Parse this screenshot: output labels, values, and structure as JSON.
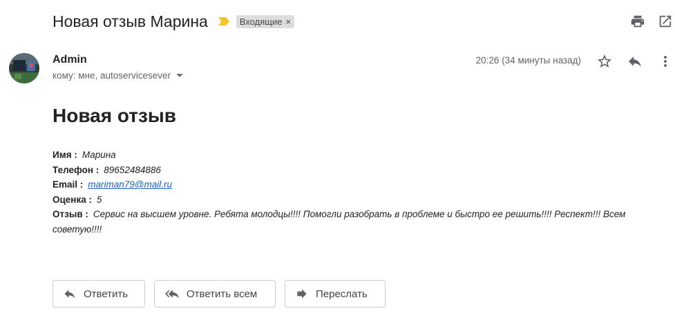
{
  "subject": {
    "title": "Новая отзыв Марина",
    "importance_icon": "importance-arrow",
    "label": "Входящие",
    "label_close": "×"
  },
  "toolbar": {
    "print_icon": "print-icon",
    "open_new_window_icon": "open-in-new-icon"
  },
  "message": {
    "sender_name": "Admin",
    "recipients": "кому: мне, autoservicesever",
    "timestamp": "20:26 (34 минуты назад)",
    "icons": [
      "star-icon",
      "reply-icon",
      "more-vert-icon"
    ]
  },
  "body": {
    "heading": "Новая отзыв",
    "fields": [
      {
        "key": "Имя :",
        "value": "Марина"
      },
      {
        "key": "Телефон :",
        "value": "89652484886"
      },
      {
        "key": "Email :",
        "value": "mariman79@mail.ru"
      },
      {
        "key": "Оценка :",
        "value": "5"
      },
      {
        "key": "Отзыв :",
        "value": "Сервис на высшем уровне. Ребята молодцы!!!! Помогли разобрать в проблеме и быстро ее решить!!!! Респект!!! Всем советую!!!!"
      }
    ]
  },
  "actions": {
    "reply": "Ответить",
    "reply_all": "Ответить всем",
    "forward": "Переслать"
  },
  "colors": {
    "importance": "#f4c430",
    "link": "#1a5fc7",
    "icon": "#5f6368"
  }
}
